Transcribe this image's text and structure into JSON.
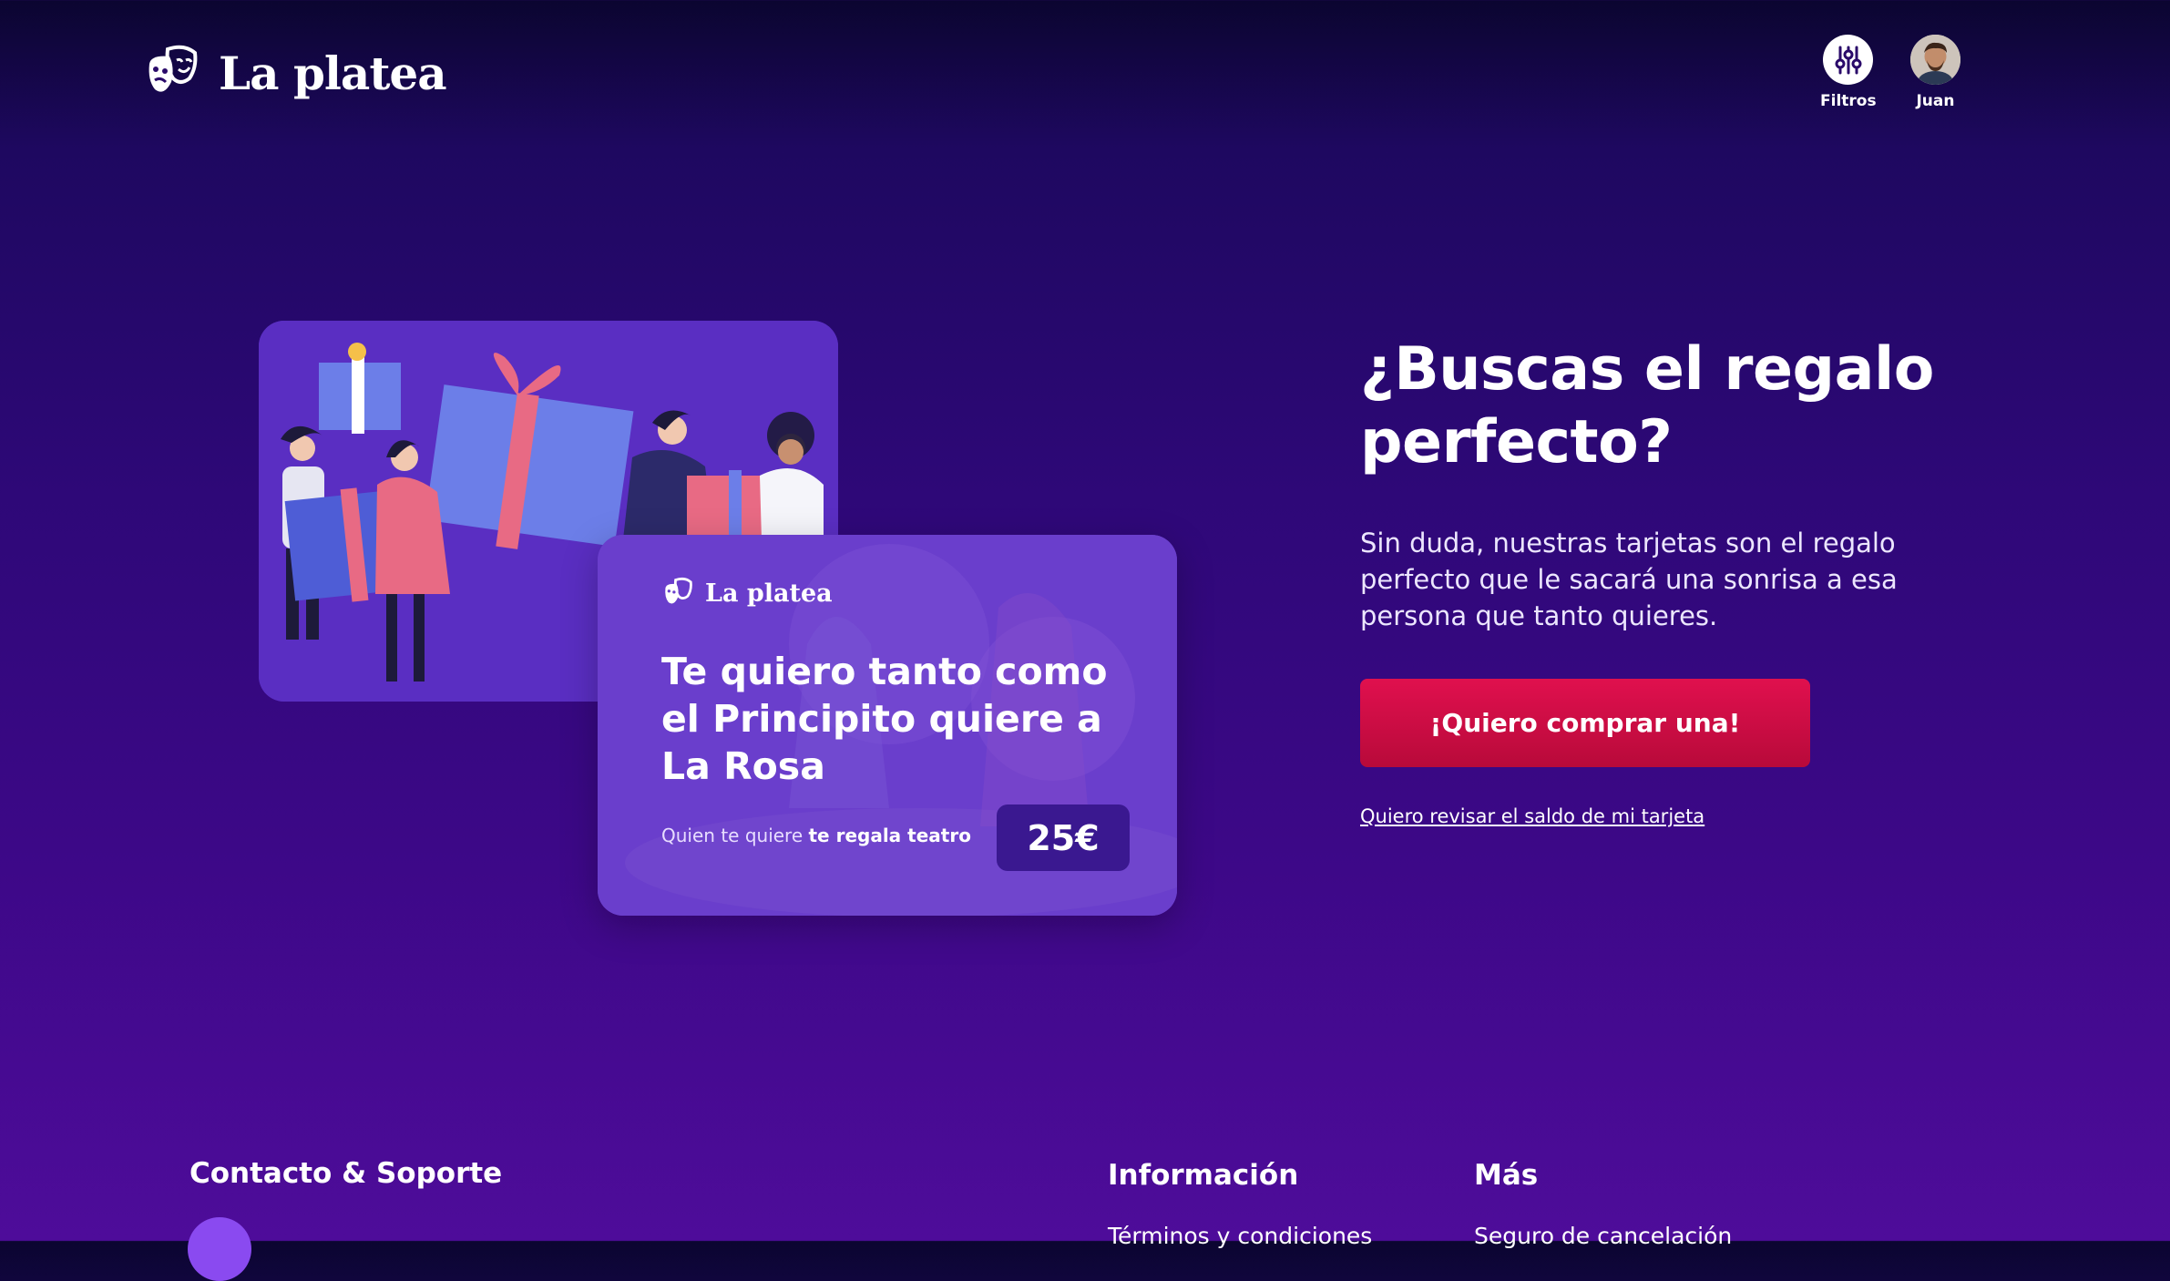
{
  "header": {
    "brand": "La platea",
    "filters_label": "Filtros",
    "user_label": "Juan"
  },
  "gift_card": {
    "brand": "La platea",
    "title": "Te quiero tanto como el Principito quiere a La Rosa",
    "footer_prefix": "Quien te quiere",
    "footer_bold": "te regala teatro",
    "price": "25€"
  },
  "hero": {
    "title": "¿Buscas el regalo perfecto?",
    "description": "Sin duda, nuestras tarjetas son el regalo perfecto que le sacará una sonrisa a esa persona que tanto quieres.",
    "cta_label": "¡Quiero comprar una!",
    "balance_link": "Quiero revisar el saldo de mi tarjeta"
  },
  "footer": {
    "contact_heading": "Contacto & Soporte",
    "info_heading": "Información",
    "info_link": "Términos y condiciones",
    "more_heading": "Más",
    "more_link": "Seguro de cancelación"
  },
  "colors": {
    "cta": "#d20c47",
    "card": "#6a3ecc",
    "background": "#2e0878"
  }
}
